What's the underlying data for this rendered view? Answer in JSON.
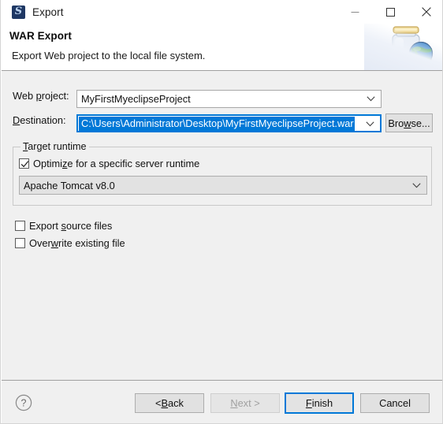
{
  "window": {
    "title": "Export",
    "app_icon": "myeclipse-icon",
    "controls": {
      "minimize": "minimize-icon",
      "maximize": "maximize-icon",
      "close": "close-icon"
    }
  },
  "header": {
    "title": "WAR Export",
    "description": "Export Web project to the local file system.",
    "banner_icon": "jar-globe-banner-icon"
  },
  "form": {
    "web_project": {
      "label_pre": "Web ",
      "label_mnemonic": "p",
      "label_post": "roject:",
      "value": "MyFirstMyeclipseProject",
      "chevron": "chevron-down-icon"
    },
    "destination": {
      "label_mnemonic": "D",
      "label_post": "estination:",
      "value": "C:\\Users\\Administrator\\Desktop\\MyFirstMyeclipseProject.war",
      "selected": true,
      "chevron": "chevron-down-icon",
      "selection_color": "#0078d7",
      "focus_color": "#0078d7"
    },
    "browse_button": {
      "label_pre": "Bro",
      "label_mnemonic": "w",
      "label_post": "se..."
    }
  },
  "target_runtime": {
    "group_mnemonic": "T",
    "group_post": "arget runtime",
    "optimize_checkbox": {
      "label_pre": "Optimi",
      "label_mnemonic": "z",
      "label_post": "e for a specific server runtime",
      "checked": true
    },
    "runtime_combo": {
      "value": "Apache Tomcat v8.0",
      "chevron": "chevron-down-icon",
      "enabled": true
    }
  },
  "options": [
    {
      "name": "export-source-files",
      "label_pre": "Export ",
      "label_mnemonic": "s",
      "label_post": "ource files",
      "checked": false
    },
    {
      "name": "overwrite-existing-file",
      "label_pre": "Over",
      "label_mnemonic": "w",
      "label_post": "rite existing file",
      "checked": false
    }
  ],
  "footer": {
    "help_icon": "help-question-icon",
    "buttons": [
      {
        "name": "back-button",
        "label_pre": "< ",
        "label_mnemonic": "B",
        "label_post": "ack",
        "enabled": true,
        "default": false
      },
      {
        "name": "next-button",
        "label_pre": "",
        "label_mnemonic": "N",
        "label_post": "ext >",
        "enabled": false,
        "default": false
      },
      {
        "name": "finish-button",
        "label_pre": "",
        "label_mnemonic": "F",
        "label_post": "inish",
        "enabled": true,
        "default": true
      },
      {
        "name": "cancel-button",
        "label_pre": "Cancel",
        "label_mnemonic": "",
        "label_post": "",
        "enabled": true,
        "default": false
      }
    ]
  }
}
